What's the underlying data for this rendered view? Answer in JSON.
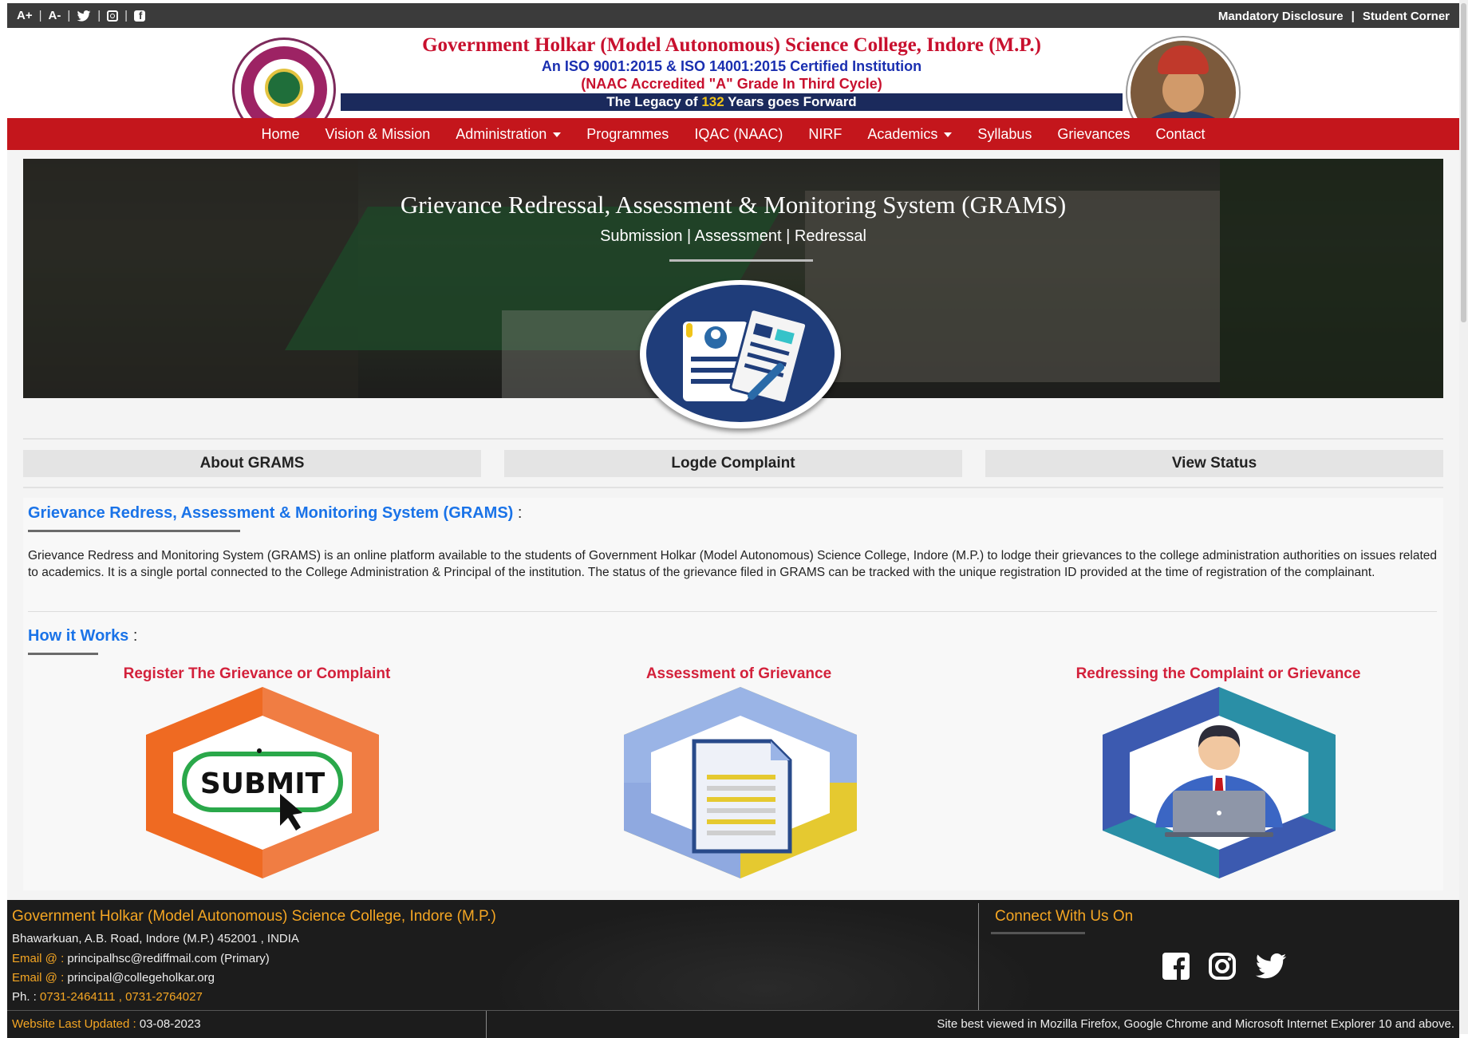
{
  "topbar": {
    "font_increase": "A+",
    "font_decrease": "A-",
    "social_icons": [
      "twitter-icon",
      "instagram-icon",
      "facebook-icon"
    ],
    "right_links": [
      "Mandatory Disclosure",
      "|",
      "Student Corner"
    ]
  },
  "header": {
    "title": "Government Holkar (Model Autonomous) Science College, Indore (M.P.)",
    "iso": "An ISO 9001:2015 & ISO 14001:2015 Certified Institution",
    "naac": "(NAAC Accredited \"A\" Grade In Third Cycle)",
    "legacy_prefix": "The Legacy of",
    "legacy_years": "132",
    "legacy_suffix": "Years goes Forward"
  },
  "nav": {
    "items": [
      {
        "label": "Home",
        "dropdown": false
      },
      {
        "label": "Vision & Mission",
        "dropdown": false
      },
      {
        "label": "Administration",
        "dropdown": true
      },
      {
        "label": "Programmes",
        "dropdown": false
      },
      {
        "label": "IQAC (NAAC)",
        "dropdown": false
      },
      {
        "label": "NIRF",
        "dropdown": false
      },
      {
        "label": "Academics",
        "dropdown": true
      },
      {
        "label": "Syllabus",
        "dropdown": false
      },
      {
        "label": "Grievances",
        "dropdown": false
      },
      {
        "label": "Contact",
        "dropdown": false
      }
    ]
  },
  "banner": {
    "title": "Grievance Redressal, Assessment & Monitoring System (GRAMS)",
    "subtitle": "Submission | Assessment | Redressal"
  },
  "tabs": {
    "about": "About GRAMS",
    "lodge": "Logde Complaint",
    "status": "View Status"
  },
  "about": {
    "heading": "Grievance Redress, Assessment & Monitoring System (GRAMS)",
    "colon": ":",
    "paragraph": "Grievance Redress and Monitoring System (GRAMS) is an online platform available to the students of Government Holkar (Model Autonomous) Science College, Indore (M.P.) to lodge their grievances to the college administration authorities on issues related to academics. It is a single portal connected to the College Administration & Principal of the institution. The status of the grievance filed in GRAMS can be tracked with the unique registration ID provided at the time of registration of the complainant."
  },
  "how": {
    "heading": "How it Works",
    "colon": ":",
    "steps": [
      {
        "label": "Register The Grievance or Complaint",
        "icon": "submit-icon",
        "icon_text": "SUBMIT"
      },
      {
        "label": "Assessment of Grievance",
        "icon": "document-icon"
      },
      {
        "label": "Redressing the Complaint or Grievance",
        "icon": "officer-laptop-icon"
      }
    ]
  },
  "footer": {
    "college_name": "Government Holkar (Model Autonomous) Science College, Indore (M.P.)",
    "address": "Bhawarkuan, A.B. Road, Indore (M.P.) 452001 , INDIA",
    "email_label": "Email @ :",
    "email1": "principalhsc@rediffmail.com (Primary)",
    "email2": "principal@collegeholkar.org",
    "phone_label": "Ph. :",
    "phone": "0731-2464111 , 0731-2764027",
    "connect_heading": "Connect With Us On",
    "last_updated_label": "Website Last Updated :",
    "last_updated": "03-08-2023",
    "browser_note": "Site best viewed in Mozilla Firefox, Google Chrome and Microsoft Internet Explorer 10 and above."
  },
  "colors": {
    "nav_red": "#c4161c",
    "title_red": "#c8102e",
    "iso_blue": "#1a2fb0",
    "heading_blue": "#1a73e8",
    "step_red": "#d3213b",
    "footer_orange": "#f5a623"
  }
}
